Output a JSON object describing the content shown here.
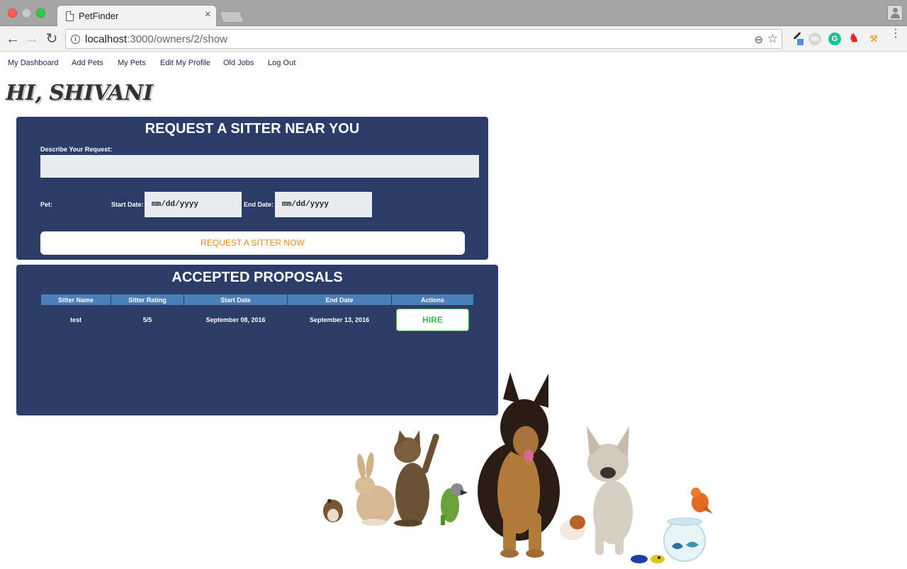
{
  "browser": {
    "tab_title": "PetFinder",
    "url_host": "localhost",
    "url_path": ":3000/owners/2/show",
    "ext_m": "m",
    "ext_g": "G"
  },
  "nav": {
    "items": [
      "My Dashboard",
      "Add Pets",
      "My Pets",
      "Edit My Profile",
      "Old Jobs",
      "Log Out"
    ]
  },
  "greeting": "HI, SHIVANI",
  "request": {
    "title": "REQUEST A SITTER NEAR YOU",
    "describe_label": "Describe Your Request:",
    "pet_label": "Pet:",
    "start_label": "Start Date:",
    "start_placeholder": "mm/dd/yyyy",
    "end_label": "End Date:",
    "end_placeholder": "mm/dd/yyyy",
    "button": "REQUEST A SITTER NOW"
  },
  "accepted": {
    "title": "ACCEPTED PROPOSALS",
    "columns": [
      "Sitter Name",
      "Sitter Rating",
      "Start Date",
      "End Date",
      "Actions"
    ],
    "rows": [
      {
        "sitter_name": "test",
        "rating": "5/5",
        "start": "September 08, 2016",
        "end": "September 13, 2016",
        "action": "HIRE"
      }
    ]
  },
  "colors": {
    "panel": "#2b3c69",
    "header": "#4b7fb8",
    "request_button_text": "#e08a1e",
    "hire": "#4caf50"
  }
}
